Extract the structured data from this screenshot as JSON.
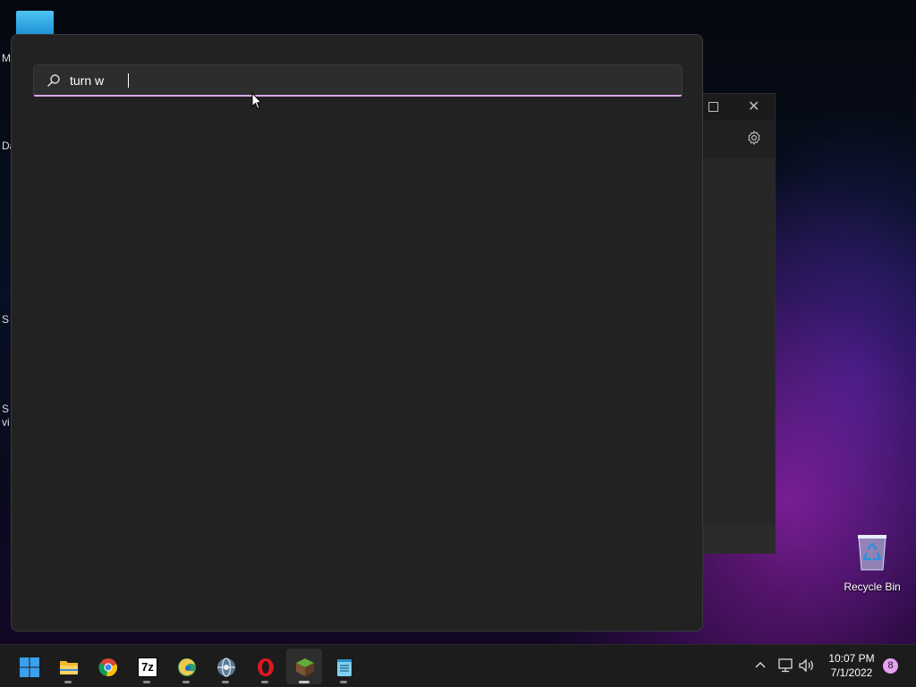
{
  "desktop": {
    "edge_letters": [
      "M",
      "Da",
      "S",
      "S",
      "vi"
    ]
  },
  "search": {
    "value": "turn w",
    "placeholder": ""
  },
  "desktop_icons": {
    "recycle_bin_label": "Recycle Bin"
  },
  "taskbar": {
    "apps": [
      "start",
      "file-explorer",
      "chrome",
      "7-zip",
      "edge-beta",
      "app-globe",
      "opera",
      "minecraft",
      "notepad"
    ],
    "seven_zip_label": "7z",
    "clock_time": "10:07 PM",
    "clock_date": "7/1/2022",
    "notification_count": "8"
  },
  "colors": {
    "accent": "#d9a6e8",
    "panel_bg": "#222222",
    "taskbar_bg": "#1c1c1c"
  }
}
